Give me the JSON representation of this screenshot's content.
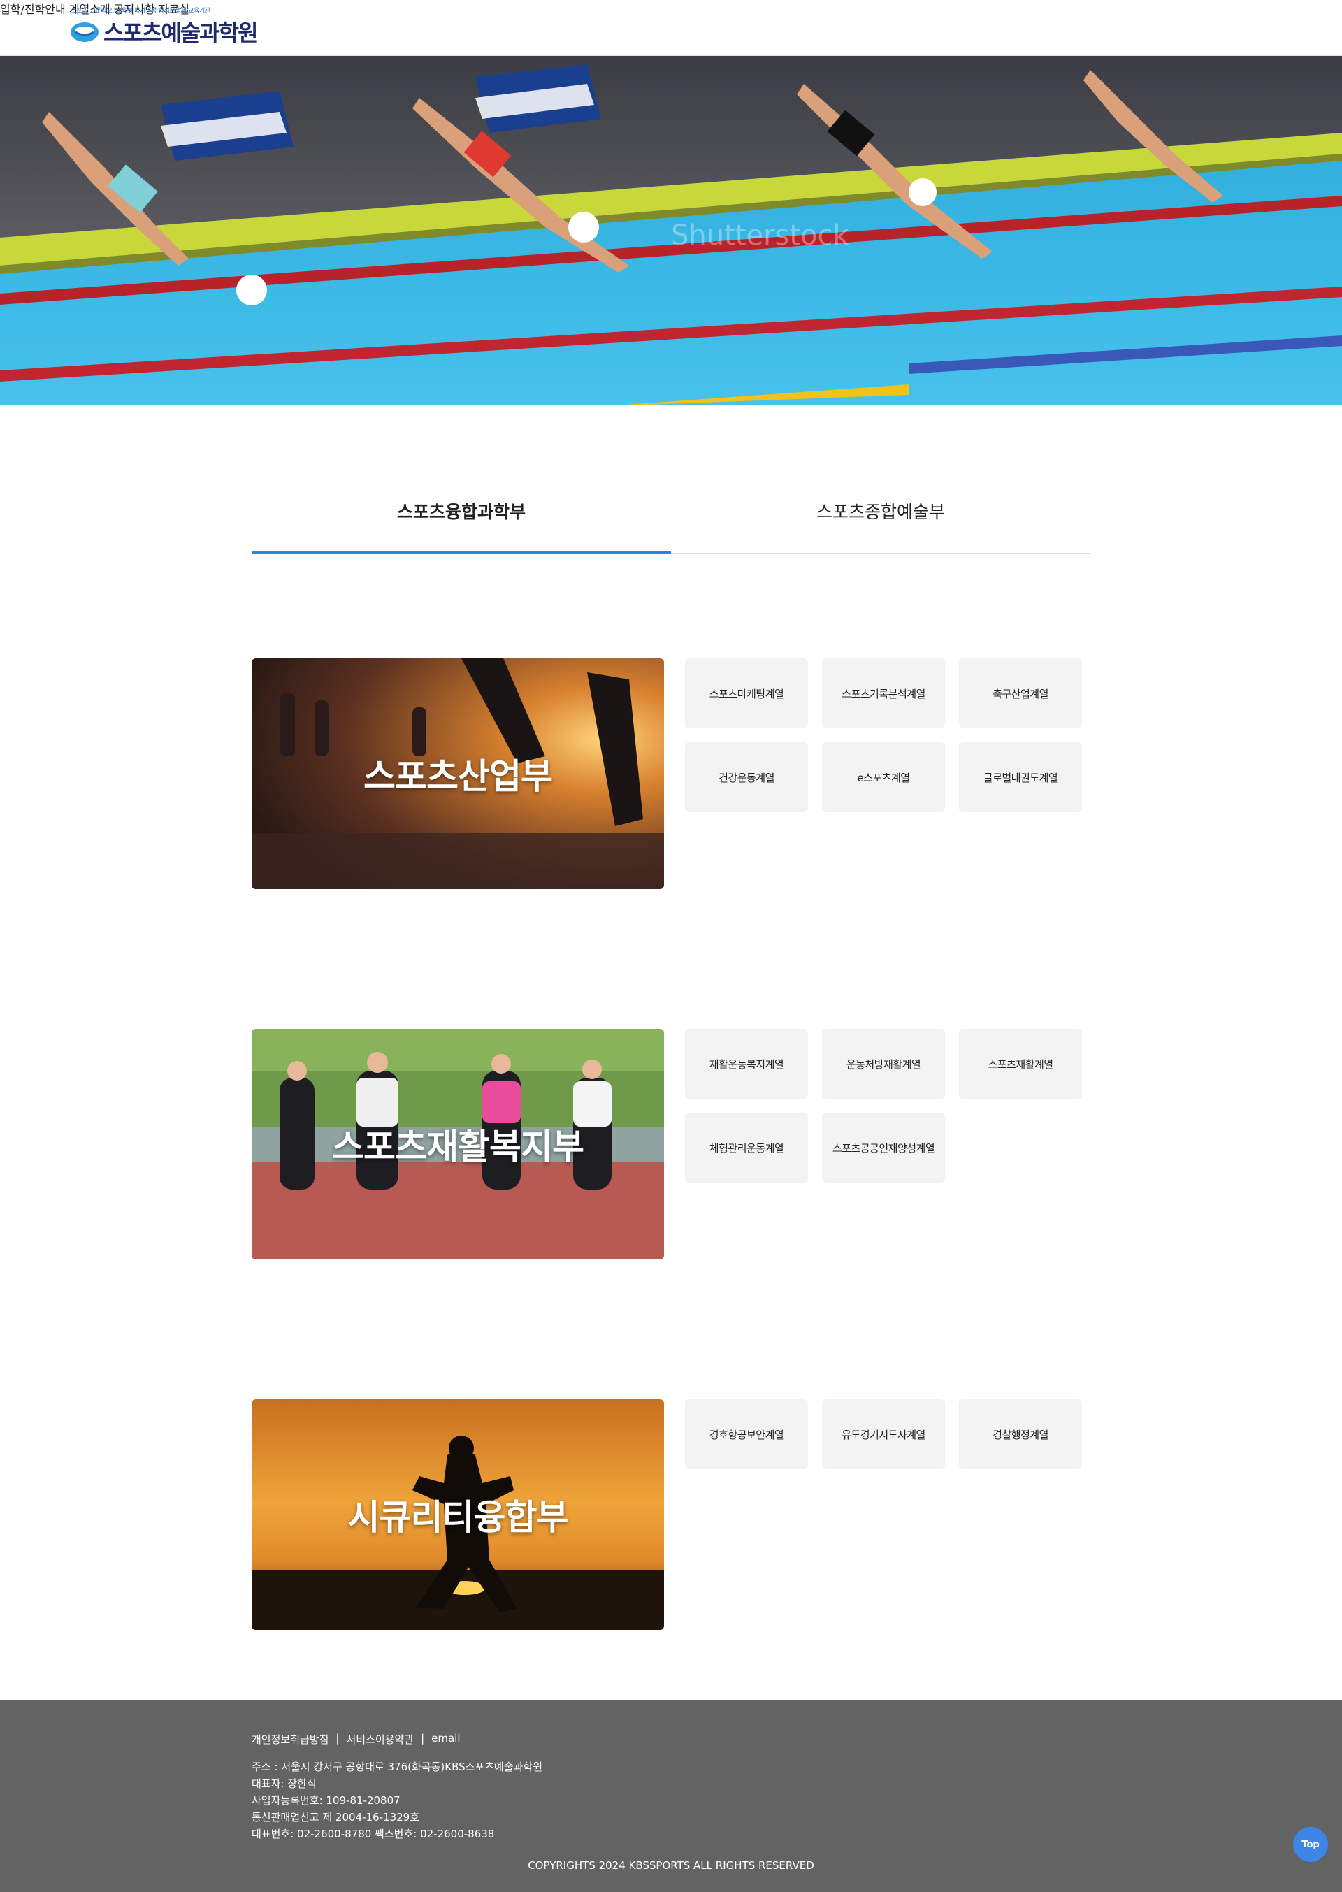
{
  "header": {
    "logo_tagline": "스포츠 전문학교, 교육부 평가인정 학점은행제 교육기관",
    "logo_name": "스포츠예술과학원",
    "nav": [
      "입학/진학안내",
      "계열소개",
      "공지사항",
      "자료실"
    ]
  },
  "hero": {
    "watermark": "Shutterstock"
  },
  "tabs": [
    "스포츠융합과학부",
    "스포츠종합예술부"
  ],
  "departments": [
    {
      "title": "스포츠산업부",
      "programs": [
        "스포츠마케팅계열",
        "스포츠기록분석계열",
        "축구산업계열",
        "건강운동계열",
        "e스포츠계열",
        "글로벌태권도계열"
      ]
    },
    {
      "title": "스포츠재활복지부",
      "programs": [
        "재활운동복지계열",
        "운동처방재활계열",
        "스포츠재활계열",
        "체형관리운동계열",
        "스포츠공공인재양성계열"
      ]
    },
    {
      "title": "시큐리티융합부",
      "programs": [
        "경호항공보안계열",
        "유도경기지도자계열",
        "경찰행정계열"
      ]
    }
  ],
  "footer": {
    "links": [
      "개인정보취급방침",
      "서비스이용약관",
      "email"
    ],
    "separator": "|",
    "address": "주소 : 서울시 강서구 공항대로 376(화곡동)KBS스포츠예술과학원",
    "ceo": "대표자: 장한식",
    "biz_no": "사업자등록번호: 109-81-20807",
    "mail_order": "통신판매업신고 제 2004-16-1329호",
    "phone": "대표번호: 02-2600-8780 팩스번호: 02-2600-8638",
    "copyright": "COPYRIGHTS 2024 KBSSPORTS ALL RIGHTS RESERVED"
  },
  "top_button": "Top",
  "colors": {
    "accent": "#2f80ed",
    "footer_bg": "#636363",
    "chip_bg": "#f3f3f3"
  }
}
